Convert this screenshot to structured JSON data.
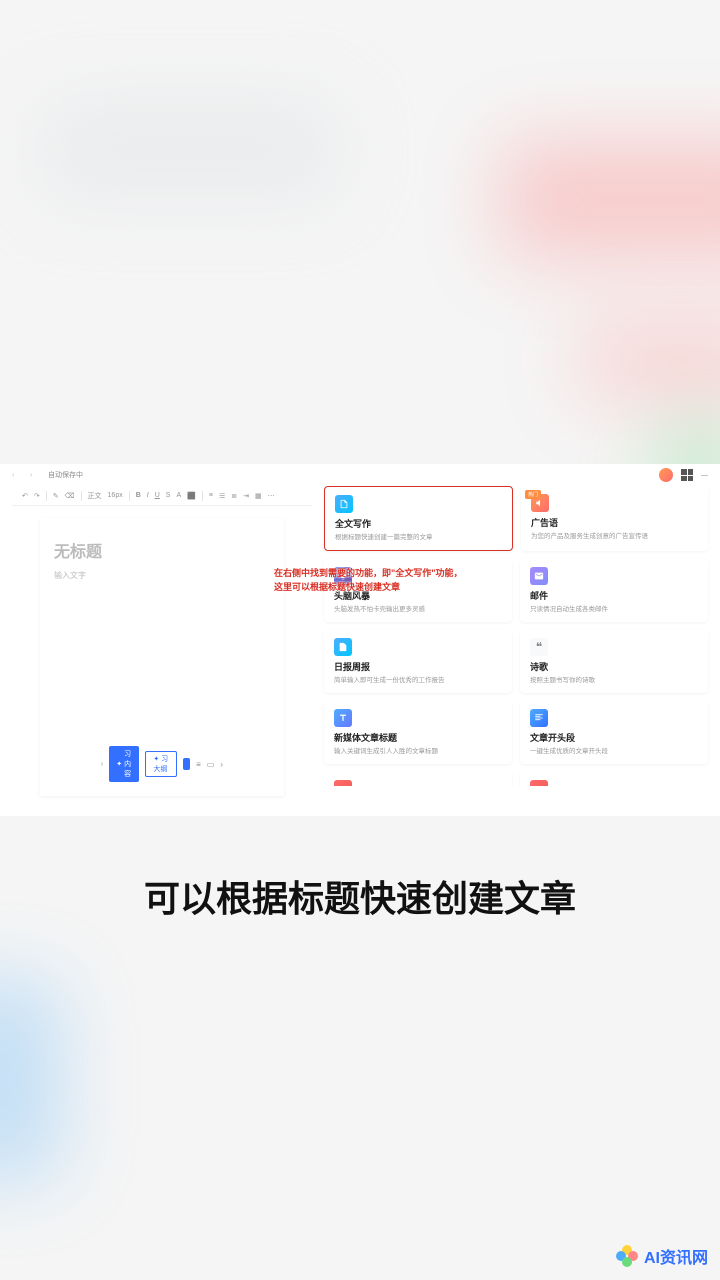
{
  "top_bar": {
    "autosave": "自动保存中"
  },
  "toolbar": {
    "font_label": "正文",
    "font_size": "16px"
  },
  "editor": {
    "title_placeholder": "无标题",
    "body_placeholder": "输入文字",
    "bottom_buttons": {
      "btn1": "习内容",
      "btn2": "习大纲"
    }
  },
  "cards": [
    {
      "title": "全文写作",
      "desc": "根据标题快速创建一篇完整的文章",
      "icon": "ic-doc",
      "highlighted": true
    },
    {
      "title": "广告语",
      "desc": "为您的产品及服务生成创意的广告宣传语",
      "icon": "ic-orange",
      "badge": "热门"
    },
    {
      "title": "头脑风暴",
      "desc": "头脑发热不怕卡壳输出更多灵感",
      "icon": "ic-headline"
    },
    {
      "title": "邮件",
      "desc": "只读情况自动生成各类邮件",
      "icon": "ic-mail"
    },
    {
      "title": "日报周报",
      "desc": "简单输入即可生成一份优秀的工作报告",
      "icon": "ic-report"
    },
    {
      "title": "诗歌",
      "desc": "按照主题书写你的诗歌",
      "icon": "ic-poem"
    },
    {
      "title": "新媒体文章标题",
      "desc": "输入关键词生成引人入胜的文章标题",
      "icon": "ic-media"
    },
    {
      "title": "文章开头段",
      "desc": "一键生成优质的文章开头段",
      "icon": "ic-para"
    }
  ],
  "annotation": {
    "line1": "在右侧中找到需要的功能，即\"全文写作\"功能，",
    "line2": "这里可以根据标题快速创建文章"
  },
  "caption": "可以根据标题快速创建文章",
  "watermark": "AI资讯网"
}
